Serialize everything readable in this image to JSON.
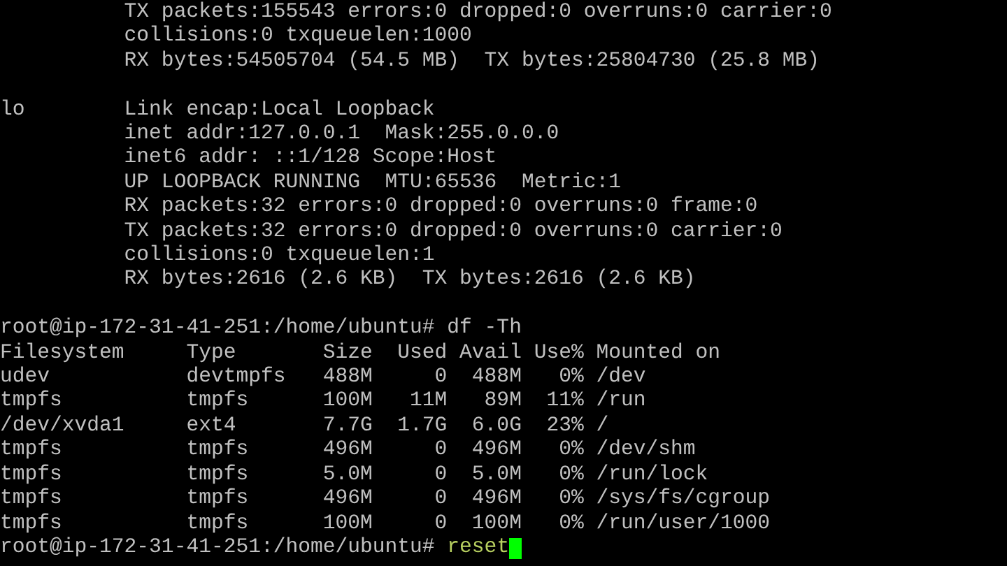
{
  "terminal": {
    "blocks": [
      {
        "lines": [
          "          TX packets:155543 errors:0 dropped:0 overruns:0 carrier:0",
          "          collisions:0 txqueuelen:1000",
          "          RX bytes:54505704 (54.5 MB)  TX bytes:25804730 (25.8 MB)"
        ]
      },
      {
        "lines": [
          "lo        Link encap:Local Loopback",
          "          inet addr:127.0.0.1  Mask:255.0.0.0",
          "          inet6 addr: ::1/128 Scope:Host",
          "          UP LOOPBACK RUNNING  MTU:65536  Metric:1",
          "          RX packets:32 errors:0 dropped:0 overruns:0 frame:0",
          "          TX packets:32 errors:0 dropped:0 overruns:0 carrier:0",
          "          collisions:0 txqueuelen:1",
          "          RX bytes:2616 (2.6 KB)  TX bytes:2616 (2.6 KB)"
        ]
      },
      {
        "lines": [
          "root@ip-172-31-41-251:/home/ubuntu# df -Th",
          "Filesystem     Type       Size  Used Avail Use% Mounted on",
          "udev           devtmpfs   488M     0  488M   0% /dev",
          "tmpfs          tmpfs      100M   11M   89M  11% /run",
          "/dev/xvda1     ext4       7.7G  1.7G  6.0G  23% /",
          "tmpfs          tmpfs      496M     0  496M   0% /dev/shm",
          "tmpfs          tmpfs      5.0M     0  5.0M   0% /run/lock",
          "tmpfs          tmpfs      496M     0  496M   0% /sys/fs/cgroup",
          "tmpfs          tmpfs      100M     0  100M   0% /run/user/1000"
        ]
      }
    ],
    "prompt": {
      "text": "root@ip-172-31-41-251:/home/ubuntu#",
      "command": "reset",
      "cursor": true
    }
  }
}
